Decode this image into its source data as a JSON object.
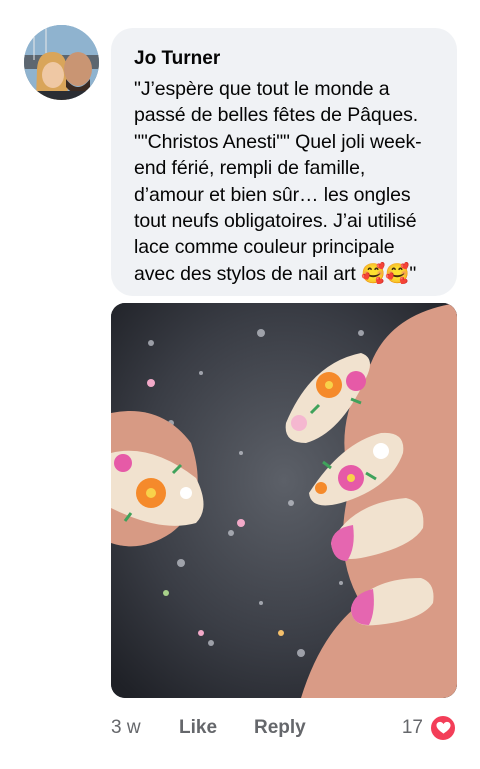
{
  "comment": {
    "author": "Jo Turner",
    "text": "\"J’espère que tout le monde a passé de belles fêtes de Pâques. \"\"Christos Anesti\"\" Quel joli week-end férié, rempli de famille, d’amour et bien sûr… les ongles tout neufs obligatoires. J’ai utilisé lace comme couleur principale avec des stylos de nail art 🥰🥰\"",
    "time": "3 w",
    "like_label": "Like",
    "reply_label": "Reply",
    "reaction_count": "17",
    "reaction_icon": "heart-icon",
    "avatar_icon": "profile-photo",
    "colors": {
      "bubble": "#f0f2f5",
      "meta_text": "#65676b",
      "heart": "#f33e58"
    }
  }
}
